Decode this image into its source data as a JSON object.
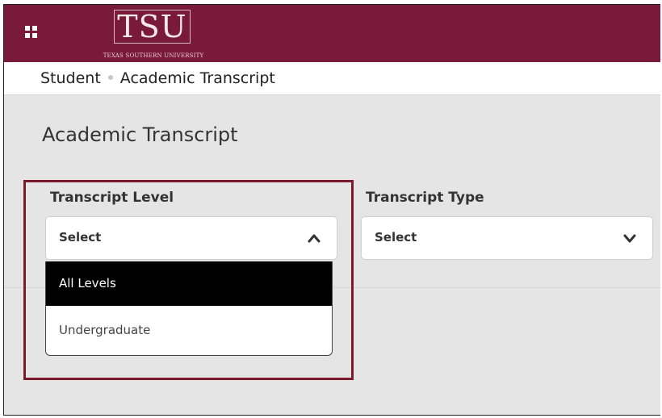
{
  "header": {
    "logo_letters": "TSU",
    "logo_subtitle": "TEXAS SOUTHERN UNIVERSITY",
    "menu_icon": "grid-menu-icon",
    "brand_color": "#7a1a3b"
  },
  "breadcrumb": {
    "items": [
      "Student",
      "Academic Transcript"
    ]
  },
  "page": {
    "title": "Academic Transcript"
  },
  "form": {
    "transcript_level": {
      "label": "Transcript Level",
      "value": "Select",
      "expanded": true,
      "options": [
        {
          "label": "All Levels",
          "highlighted": true
        },
        {
          "label": "Undergraduate",
          "highlighted": false
        }
      ]
    },
    "transcript_type": {
      "label": "Transcript Type",
      "value": "Select",
      "expanded": false
    }
  },
  "annotation": {
    "highlight_color": "#7a1a2a"
  }
}
